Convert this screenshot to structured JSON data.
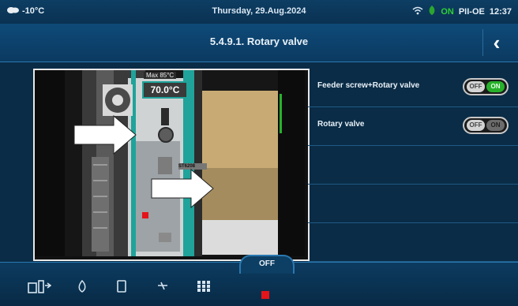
{
  "status_bar": {
    "temperature": "-10°C",
    "datetime": "Thursday, 29.Aug.2024",
    "connection_label": "ON",
    "user": "PII-OE",
    "time": "12:37"
  },
  "header": {
    "title": "5.4.9.1. Rotary valve"
  },
  "diagram": {
    "temp_label": "Max 85°C",
    "temp_value": "70.0°C",
    "tag_label": "ST6208"
  },
  "settings": [
    {
      "label": "Feeder screw+Rotary valve",
      "off_label": "OFF",
      "on_label": "ON",
      "state": "on"
    },
    {
      "label": "Rotary valve",
      "off_label": "OFF",
      "on_label": "ON",
      "state": "off"
    }
  ],
  "bottom_bar": {
    "mode_label": "OFF",
    "items": [
      "home-icon",
      "flame-icon",
      "tank-icon",
      "fan-icon",
      "grid-icon"
    ]
  },
  "colors": {
    "accent": "#27b12b",
    "header": "#0e4a78",
    "stop": "#e3141a"
  }
}
